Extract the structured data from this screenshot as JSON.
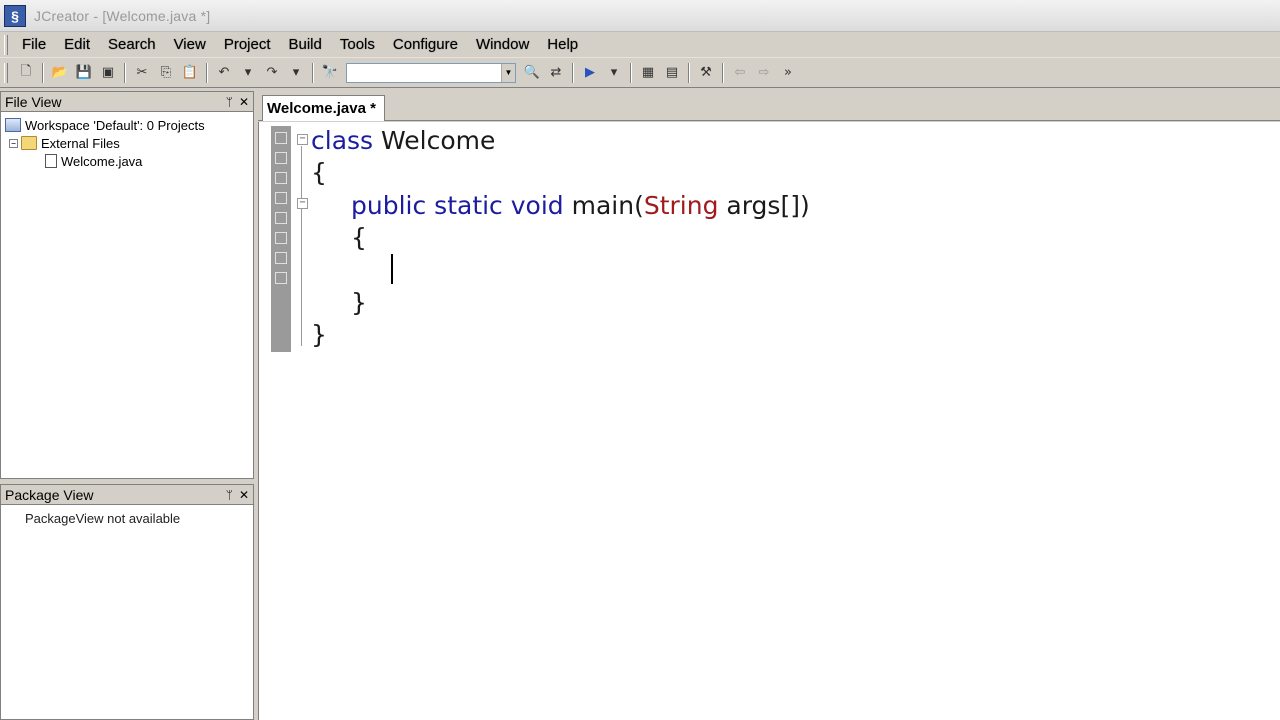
{
  "window": {
    "title": "JCreator - [Welcome.java *]"
  },
  "menu": [
    "File",
    "Edit",
    "Search",
    "View",
    "Project",
    "Build",
    "Tools",
    "Configure",
    "Window",
    "Help"
  ],
  "toolbar": {
    "search_value": ""
  },
  "file_view": {
    "title": "File View",
    "workspace": "Workspace 'Default': 0 Projects",
    "folder": "External Files",
    "file": "Welcome.java"
  },
  "package_view": {
    "title": "Package View",
    "message": "PackageView not available"
  },
  "editor": {
    "tab_label": "Welcome.java *",
    "code": {
      "l1_kw": "class",
      "l1_rest": " Welcome",
      "l2": "{",
      "l3_kw": "public static void",
      "l3_mid": " main(",
      "l3_type": "String",
      "l3_rest": " args[])",
      "l4": "{",
      "l6": "}",
      "l7": "}"
    }
  }
}
